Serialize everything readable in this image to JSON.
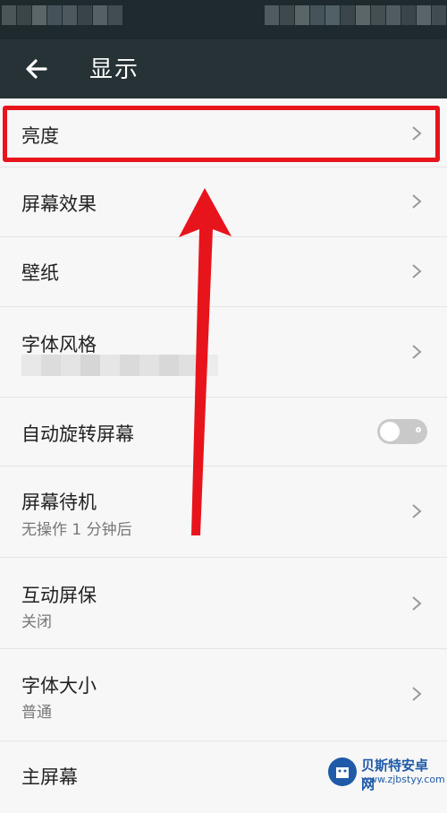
{
  "header": {
    "title": "显示"
  },
  "colors": {
    "accent_red": "#e8141c",
    "appbar": "#263236",
    "background": "#f7f7f7"
  },
  "rows": [
    {
      "label": "亮度"
    },
    {
      "label": "屏幕效果"
    },
    {
      "label": "壁纸"
    },
    {
      "label": "字体风格"
    },
    {
      "label": "自动旋转屏幕",
      "toggle": false
    },
    {
      "label": "屏幕待机",
      "sub": "无操作 1 分钟后"
    },
    {
      "label": "互动屏保",
      "sub": "关闭"
    },
    {
      "label": "字体大小",
      "sub": "普通"
    },
    {
      "label": "主屏幕"
    }
  ],
  "watermark": {
    "name": "贝斯特安卓网",
    "url": "www.zjbstyy.com"
  }
}
